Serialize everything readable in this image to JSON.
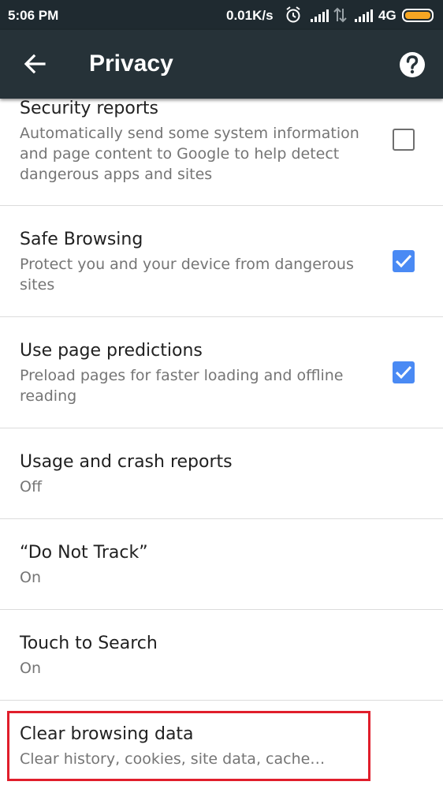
{
  "status_bar": {
    "time": "5:06 PM",
    "network_speed": "0.01K/s",
    "network_type": "4G",
    "icons": [
      "alarm-icon",
      "signal-icon",
      "data-transfer-icon",
      "signal-icon",
      "battery-icon"
    ],
    "battery_color": "#f5a623"
  },
  "app_bar": {
    "title": "Privacy",
    "background": "#263238",
    "icons": [
      "back-arrow-icon",
      "help-icon"
    ]
  },
  "settings": {
    "items": [
      {
        "title": "Security reports",
        "summary": "Automatically send some system information and page content to Google to help detect dangerous apps and sites",
        "checked": false
      },
      {
        "title": "Safe Browsing",
        "summary": "Protect you and your device from dangerous sites",
        "checked": true
      },
      {
        "title": "Use page predictions",
        "summary": "Preload pages for faster loading and offline reading",
        "checked": true
      },
      {
        "title": "Usage and crash reports",
        "summary": "Off"
      },
      {
        "title": "“Do Not Track”",
        "summary": "On"
      },
      {
        "title": "Touch to Search",
        "summary": "On"
      },
      {
        "title": "Clear browsing data",
        "summary": "Clear history, cookies, site data, cache…"
      }
    ],
    "checkbox_color": "#4a8af4",
    "highlight_color": "#e01e2b"
  }
}
